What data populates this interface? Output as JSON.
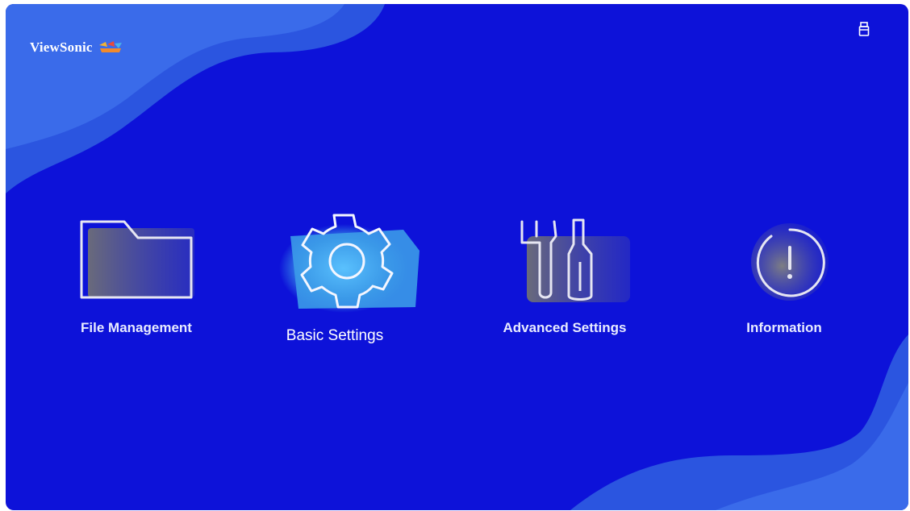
{
  "app": {
    "brand_name": "ViewSonic",
    "background_color": "#0d12d9",
    "accent_color": "#3b9be8",
    "selected_item": "Basic Settings"
  },
  "top_bar": {
    "status_icon": "usb-drive-icon"
  },
  "menu": {
    "items": [
      {
        "label": "File Management",
        "icon": "folder-icon",
        "selected": false
      },
      {
        "label": "Basic Settings",
        "icon": "gear-icon",
        "selected": true
      },
      {
        "label": "Advanced Settings",
        "icon": "tools-icon",
        "selected": false
      },
      {
        "label": "Information",
        "icon": "info-icon",
        "selected": false
      }
    ]
  }
}
